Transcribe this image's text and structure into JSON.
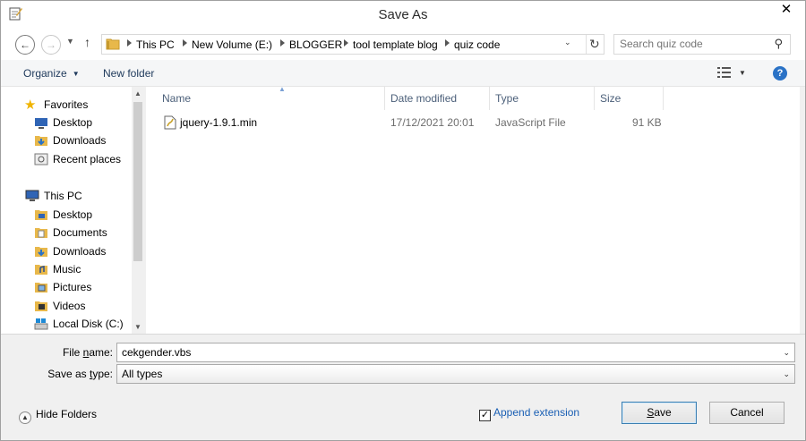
{
  "window": {
    "title": "Save As",
    "close_symbol": "✕"
  },
  "nav": {
    "back_icon": "arrow-left-icon",
    "forward_icon": "arrow-right-icon",
    "up_icon": "arrow-up-icon",
    "breadcrumbs": [
      "This PC",
      "New Volume (E:)",
      "BLOGGER",
      "tool template blog",
      "quiz code"
    ]
  },
  "search": {
    "placeholder": "Search quiz code"
  },
  "toolbar": {
    "organize_label": "Organize",
    "new_folder_label": "New folder"
  },
  "sidebar": {
    "favorites": {
      "label": "Favorites",
      "items": [
        "Desktop",
        "Downloads",
        "Recent places"
      ]
    },
    "this_pc": {
      "label": "This PC",
      "items": [
        "Desktop",
        "Documents",
        "Downloads",
        "Music",
        "Pictures",
        "Videos",
        "Local Disk (C:)"
      ]
    }
  },
  "files": {
    "columns": [
      "Name",
      "Date modified",
      "Type",
      "Size"
    ],
    "rows": [
      {
        "name": "jquery-1.9.1.min",
        "date": "17/12/2021 20:01",
        "type": "JavaScript File",
        "size": "91 KB"
      }
    ]
  },
  "form": {
    "file_name_label_pre": "File ",
    "file_name_label_u": "n",
    "file_name_label_post": "ame:",
    "file_name_value": "cekgender.vbs",
    "save_type_label_pre": "Save as ",
    "save_type_label_u": "t",
    "save_type_label_post": "ype:",
    "save_type_value": "All types"
  },
  "footer": {
    "hide_folders_label": "Hide Folders",
    "append_extension_label": "Append extension",
    "append_extension_checked": true,
    "save_label_u": "S",
    "save_label_post": "ave",
    "cancel_label": "Cancel"
  },
  "colors": {
    "accent": "#2a72c6",
    "link": "#1a5fb4",
    "folder": "#e8b84a"
  }
}
